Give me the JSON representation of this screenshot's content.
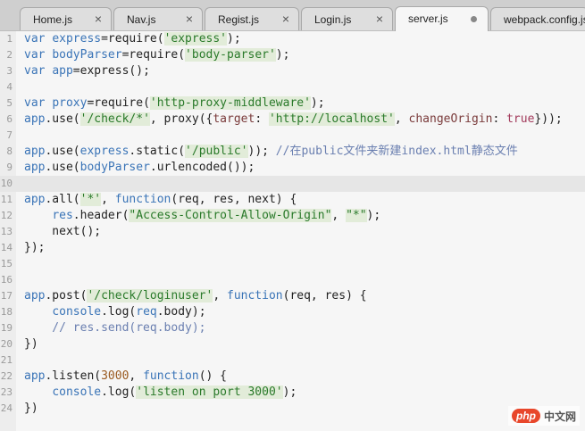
{
  "tabs": [
    {
      "label": "Home.js",
      "close": "×"
    },
    {
      "label": "Nav.js",
      "close": "×"
    },
    {
      "label": "Regist.js",
      "close": "×"
    },
    {
      "label": "Login.js",
      "close": "×"
    },
    {
      "label": "server.js"
    },
    {
      "label": "webpack.config.js"
    }
  ],
  "watermark": {
    "php": "php",
    "cn": "中文网"
  }
}
